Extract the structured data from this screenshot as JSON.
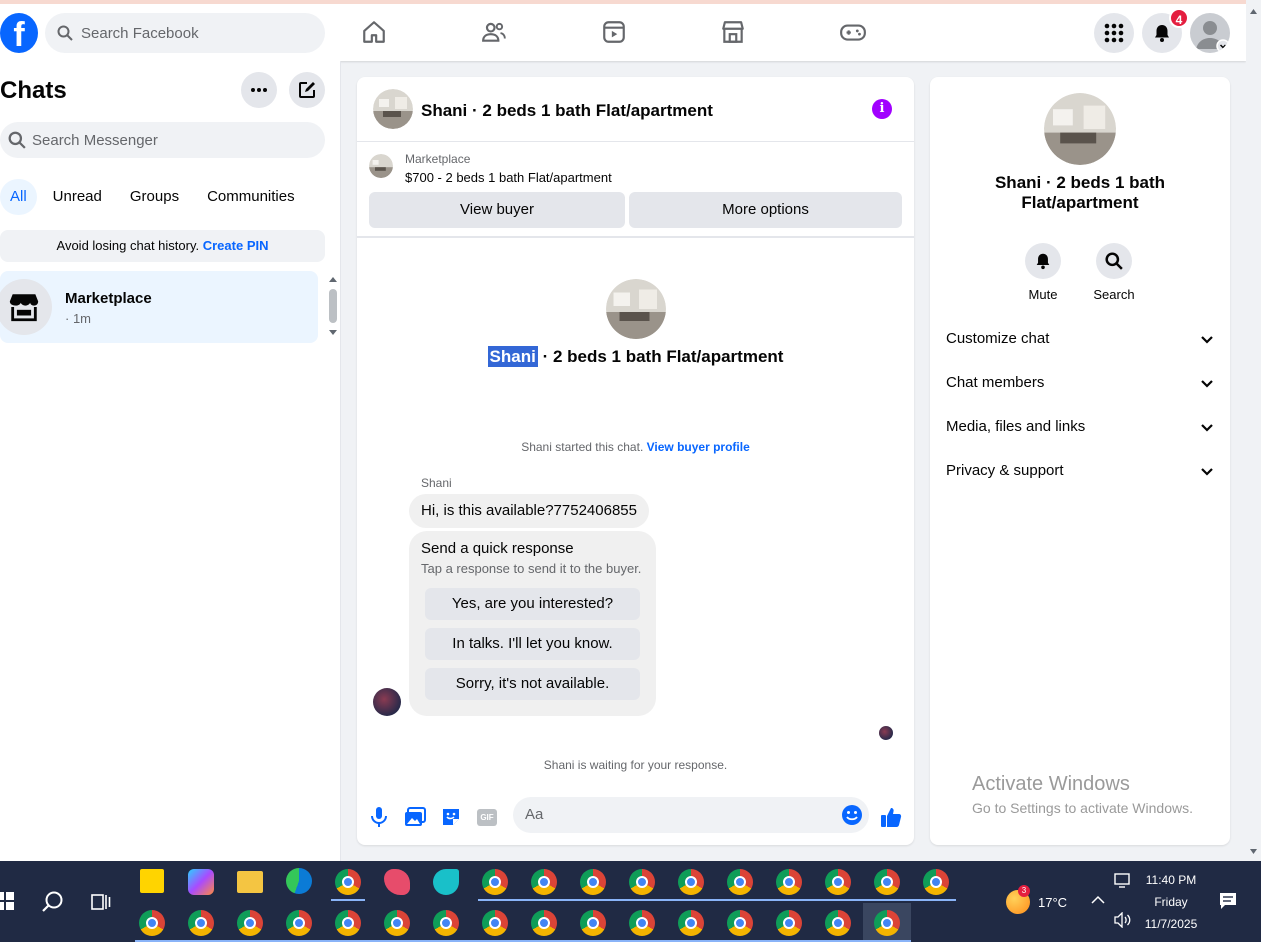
{
  "topbar": {
    "logo": "f",
    "search_placeholder": "Search Facebook",
    "notification_count": "4"
  },
  "sidebar": {
    "title": "Chats",
    "search_placeholder": "Search Messenger",
    "filters": [
      "All",
      "Unread",
      "Groups",
      "Communities"
    ],
    "pin_text": "Avoid losing chat history.",
    "pin_link": "Create PIN",
    "chats": [
      {
        "name": "Marketplace",
        "time": "· 1m"
      }
    ]
  },
  "chat": {
    "title": "Shani · 2 beds 1 bath Flat/apartment",
    "info_glyph": "i",
    "marketplace_label": "Marketplace",
    "listing": "$700 - 2 beds 1 bath Flat/apartment",
    "view_buyer": "View buyer",
    "more_options": "More options",
    "intro_highlight": "Shani",
    "intro_rest": " · 2 beds 1 bath Flat/apartment",
    "started_text": "Shani started this chat.",
    "started_link": "View buyer profile",
    "sender": "Shani",
    "message": "Hi, is this available?7752406855",
    "quick_title": "Send a quick response",
    "quick_sub": "Tap a response to send it to the buyer.",
    "quick_responses": [
      "Yes, are you interested?",
      "In talks. I'll let you know.",
      "Sorry, it's not available."
    ],
    "waiting": "Shani is waiting for your response.",
    "input_placeholder": "Aa",
    "gif_label": "GIF"
  },
  "details": {
    "name": "Shani · 2 beds 1 bath Flat/apartment",
    "actions": [
      {
        "label": "Mute"
      },
      {
        "label": "Search"
      }
    ],
    "sections": [
      "Customize chat",
      "Chat members",
      "Media, files and links",
      "Privacy & support"
    ]
  },
  "watermark": {
    "line1": "Activate Windows",
    "line2": "Go to Settings to activate Windows."
  },
  "taskbar": {
    "weather_badge": "3",
    "temperature": "17°C",
    "time": "11:40 PM",
    "day": "Friday",
    "date": "11/7/2025"
  },
  "colors": {
    "brand": "#0866ff",
    "info": "#a100ff",
    "taskbar": "#202a44"
  }
}
